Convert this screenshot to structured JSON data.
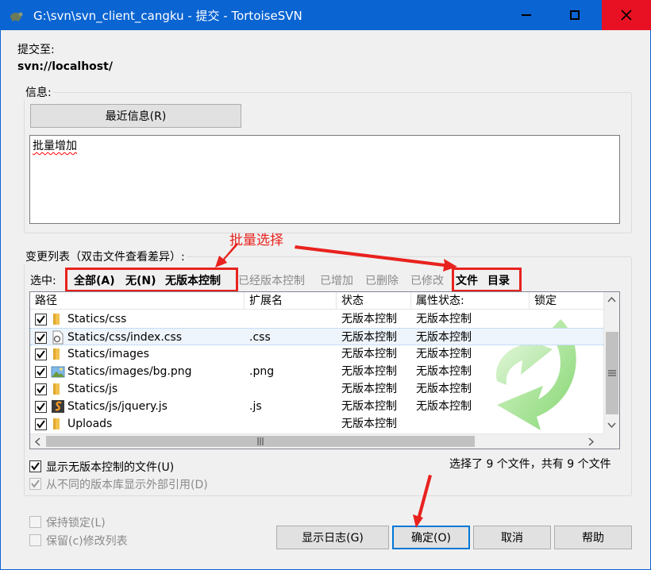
{
  "window": {
    "title": "G:\\svn\\svn_client_cangku - 提交 - TortoiseSVN"
  },
  "commit_to": {
    "label": "提交至:",
    "url": "svn://localhost/"
  },
  "message": {
    "group_label": "信息:",
    "recent_button": "最近信息(R)",
    "text": "批量增加"
  },
  "changes": {
    "group_label": "变更列表（双击文件查看差异）:",
    "select_label": "选中:",
    "select_options": {
      "all": "全部(A)",
      "none": "无(N)",
      "unversioned": "无版本控制",
      "versioned": "已经版本控制",
      "added": "已增加",
      "deleted": "已删除",
      "modified": "已修改",
      "files": "文件",
      "dirs": "目录"
    },
    "columns": [
      "路径",
      "扩展名",
      "状态",
      "属性状态:",
      "锁定"
    ],
    "rows": [
      {
        "path": "Statics/css",
        "ext": "",
        "status": "无版本控制",
        "prop": "无版本控制",
        "icon": "folder-icon"
      },
      {
        "path": "Statics/css/index.css",
        "ext": ".css",
        "status": "无版本控制",
        "prop": "无版本控制",
        "icon": "css-file-icon"
      },
      {
        "path": "Statics/images",
        "ext": "",
        "status": "无版本控制",
        "prop": "无版本控制",
        "icon": "folder-icon"
      },
      {
        "path": "Statics/images/bg.png",
        "ext": ".png",
        "status": "无版本控制",
        "prop": "无版本控制",
        "icon": "image-file-icon"
      },
      {
        "path": "Statics/js",
        "ext": "",
        "status": "无版本控制",
        "prop": "无版本控制",
        "icon": "folder-icon"
      },
      {
        "path": "Statics/js/jquery.js",
        "ext": ".js",
        "status": "无版本控制",
        "prop": "无版本控制",
        "icon": "js-file-icon"
      },
      {
        "path": "Uploads",
        "ext": "",
        "status": "无版本控制",
        "prop": "",
        "icon": "folder-icon"
      }
    ],
    "summary": "选择了 9 个文件，共有 9 个文件"
  },
  "options": {
    "show_unversioned": "显示无版本控制的文件(U)",
    "show_externals": "从不同的版本库显示外部引用(D)",
    "keep_locks": "保持锁定(L)",
    "keep_changelist": "保留(c)修改列表"
  },
  "buttons": {
    "show_log": "显示日志(G)",
    "ok": "确定(O)",
    "cancel": "取消",
    "help": "帮助"
  },
  "annotation": {
    "text": "批量选择"
  },
  "colors": {
    "titlebar": "#0a64d2",
    "close": "#e81123",
    "annotation": "#e8221e"
  }
}
